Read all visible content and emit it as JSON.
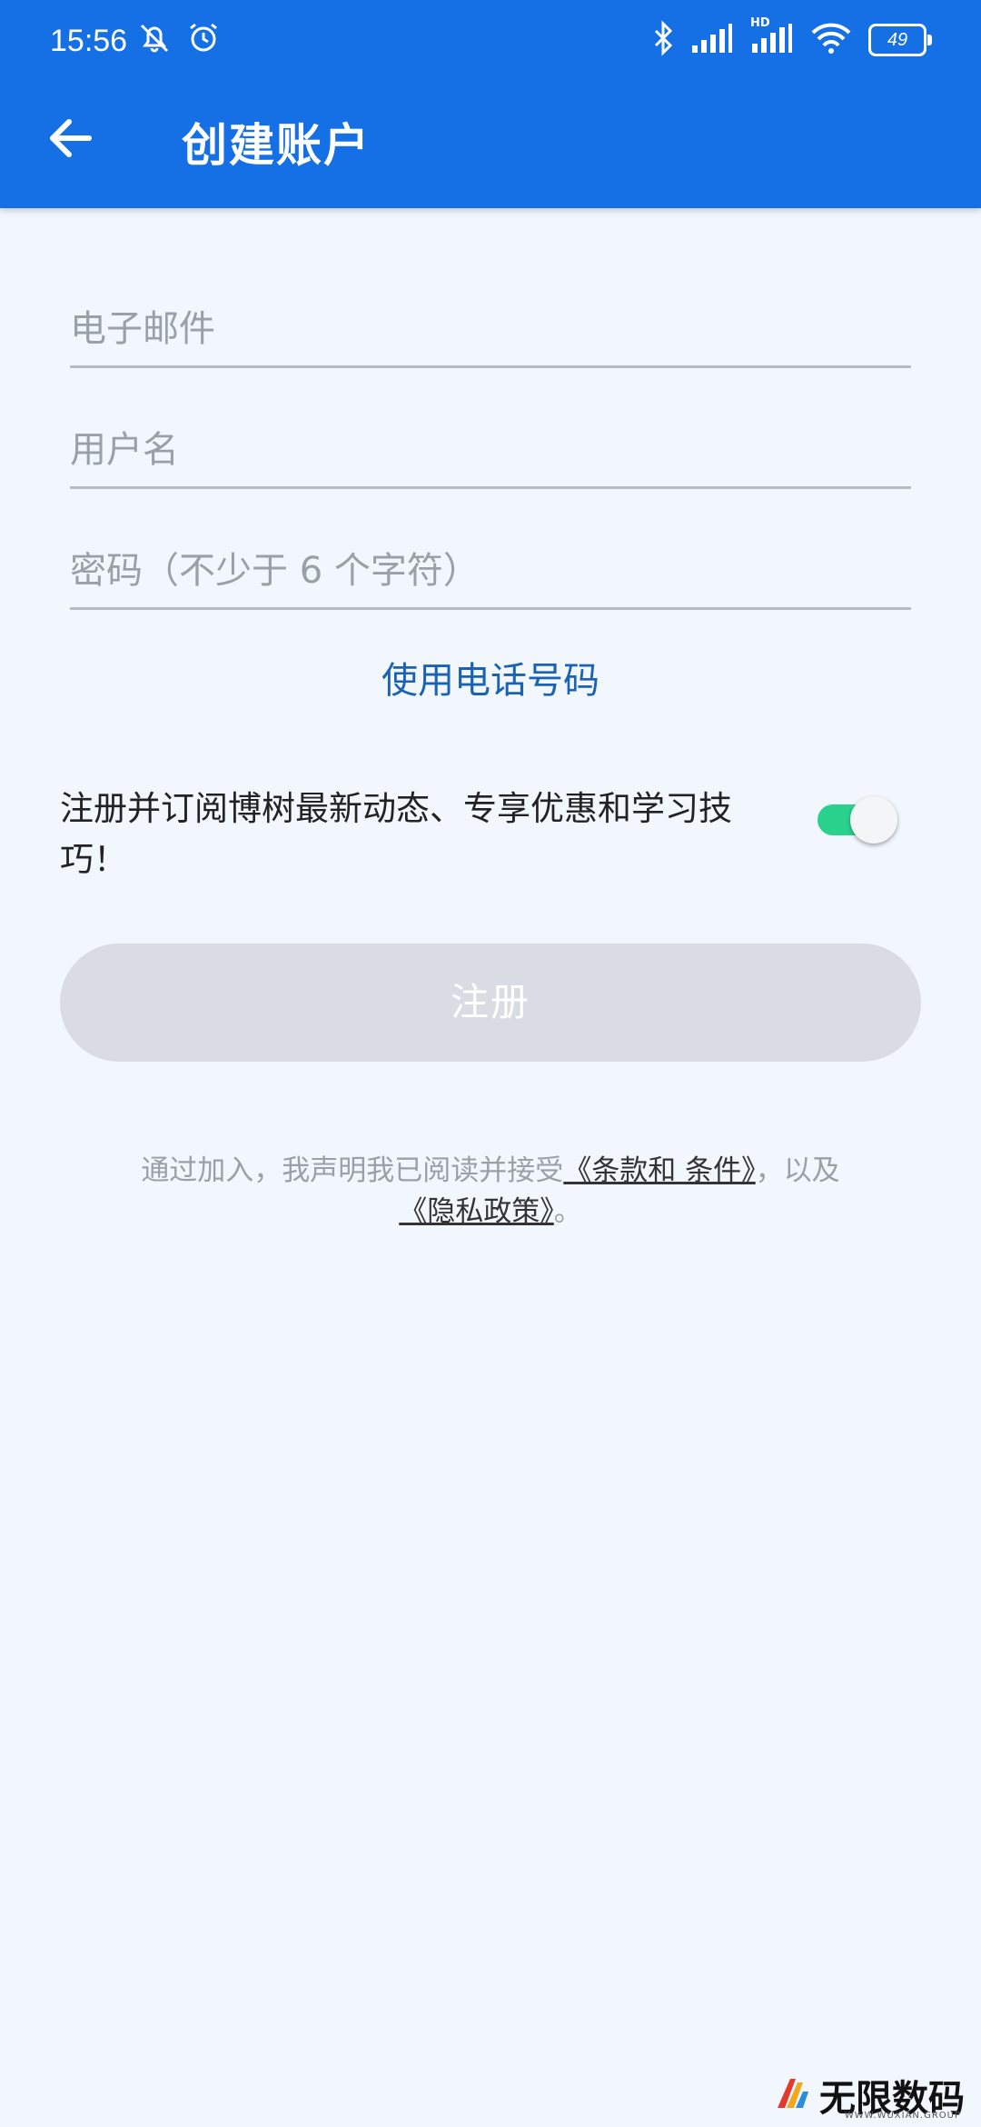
{
  "status_bar": {
    "time": "15:56",
    "network_label": "HD",
    "battery_level": "49"
  },
  "header": {
    "title": "创建账户"
  },
  "form": {
    "email_placeholder": "电子邮件",
    "username_placeholder": "用户名",
    "password_placeholder": "密码（不少于 6 个字符）",
    "use_phone_link": "使用电话号码"
  },
  "optin": {
    "text": "注册并订阅博树最新动态、专享优惠和学习技巧！",
    "enabled": true
  },
  "register_button": "注册",
  "legal": {
    "prefix": "通过加入，我声明我已阅读并接受",
    "terms_link": "《条款和 条件》",
    "middle": "，以及",
    "privacy_link": "《隐私政策》",
    "suffix": "。"
  },
  "watermark": {
    "brand": "无限数码",
    "site": "WWW.WUXIAN.GROUP"
  },
  "colors": {
    "accent": "#1570e6",
    "link": "#1a63b4",
    "toggle_on": "#2ad28e",
    "button_disabled": "#d9dde3",
    "background": "#f2f6fd"
  }
}
